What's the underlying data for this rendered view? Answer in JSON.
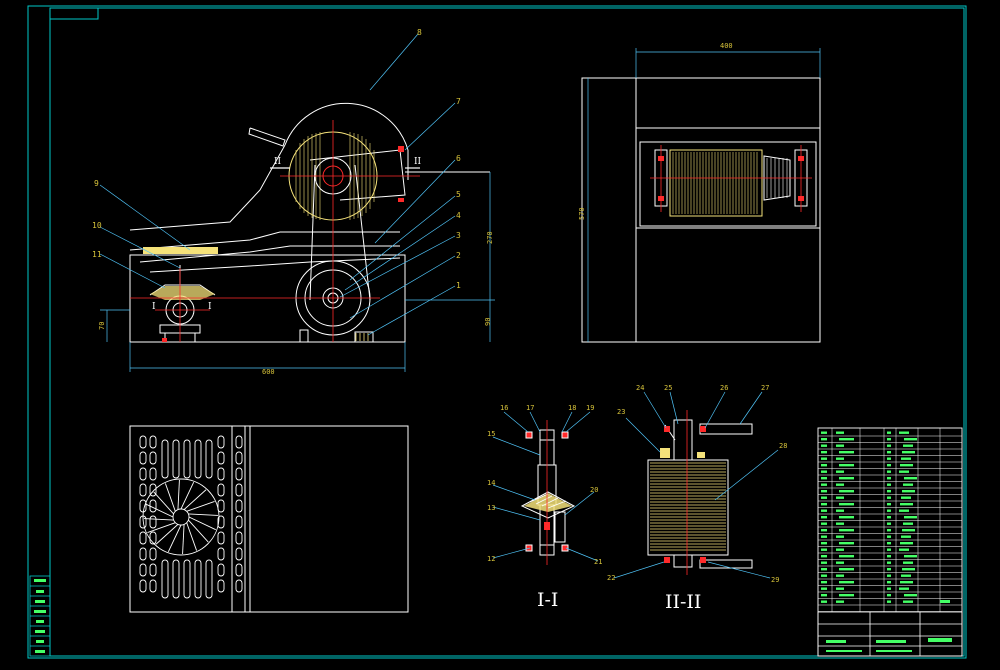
{
  "colors": {
    "background": "#000000",
    "frame": "#00c8c8",
    "outline": "#ffffff",
    "leader": "#4fc3f7",
    "label": "#d6c23a",
    "fill": "#f5e27a",
    "centerline": "#ff2a2a",
    "tableText": "#44ff66"
  },
  "drawing": {
    "part_numbers": [
      "1",
      "2",
      "3",
      "4",
      "5",
      "6",
      "7",
      "8",
      "9",
      "10",
      "11"
    ],
    "roman_I": "I",
    "roman_II": "II",
    "dims": {
      "d400": "400",
      "d570": "570",
      "d270": "270",
      "d70": "70",
      "d90": "90",
      "d600": "600"
    },
    "section_I_labels": [
      "12",
      "13",
      "14",
      "15",
      "16",
      "17",
      "18",
      "19",
      "20",
      "21"
    ],
    "section_II_labels": [
      "22",
      "23",
      "24",
      "25",
      "26",
      "27",
      "28",
      "29"
    ],
    "section_I_title": "I-I",
    "section_II_title": "II-II"
  }
}
